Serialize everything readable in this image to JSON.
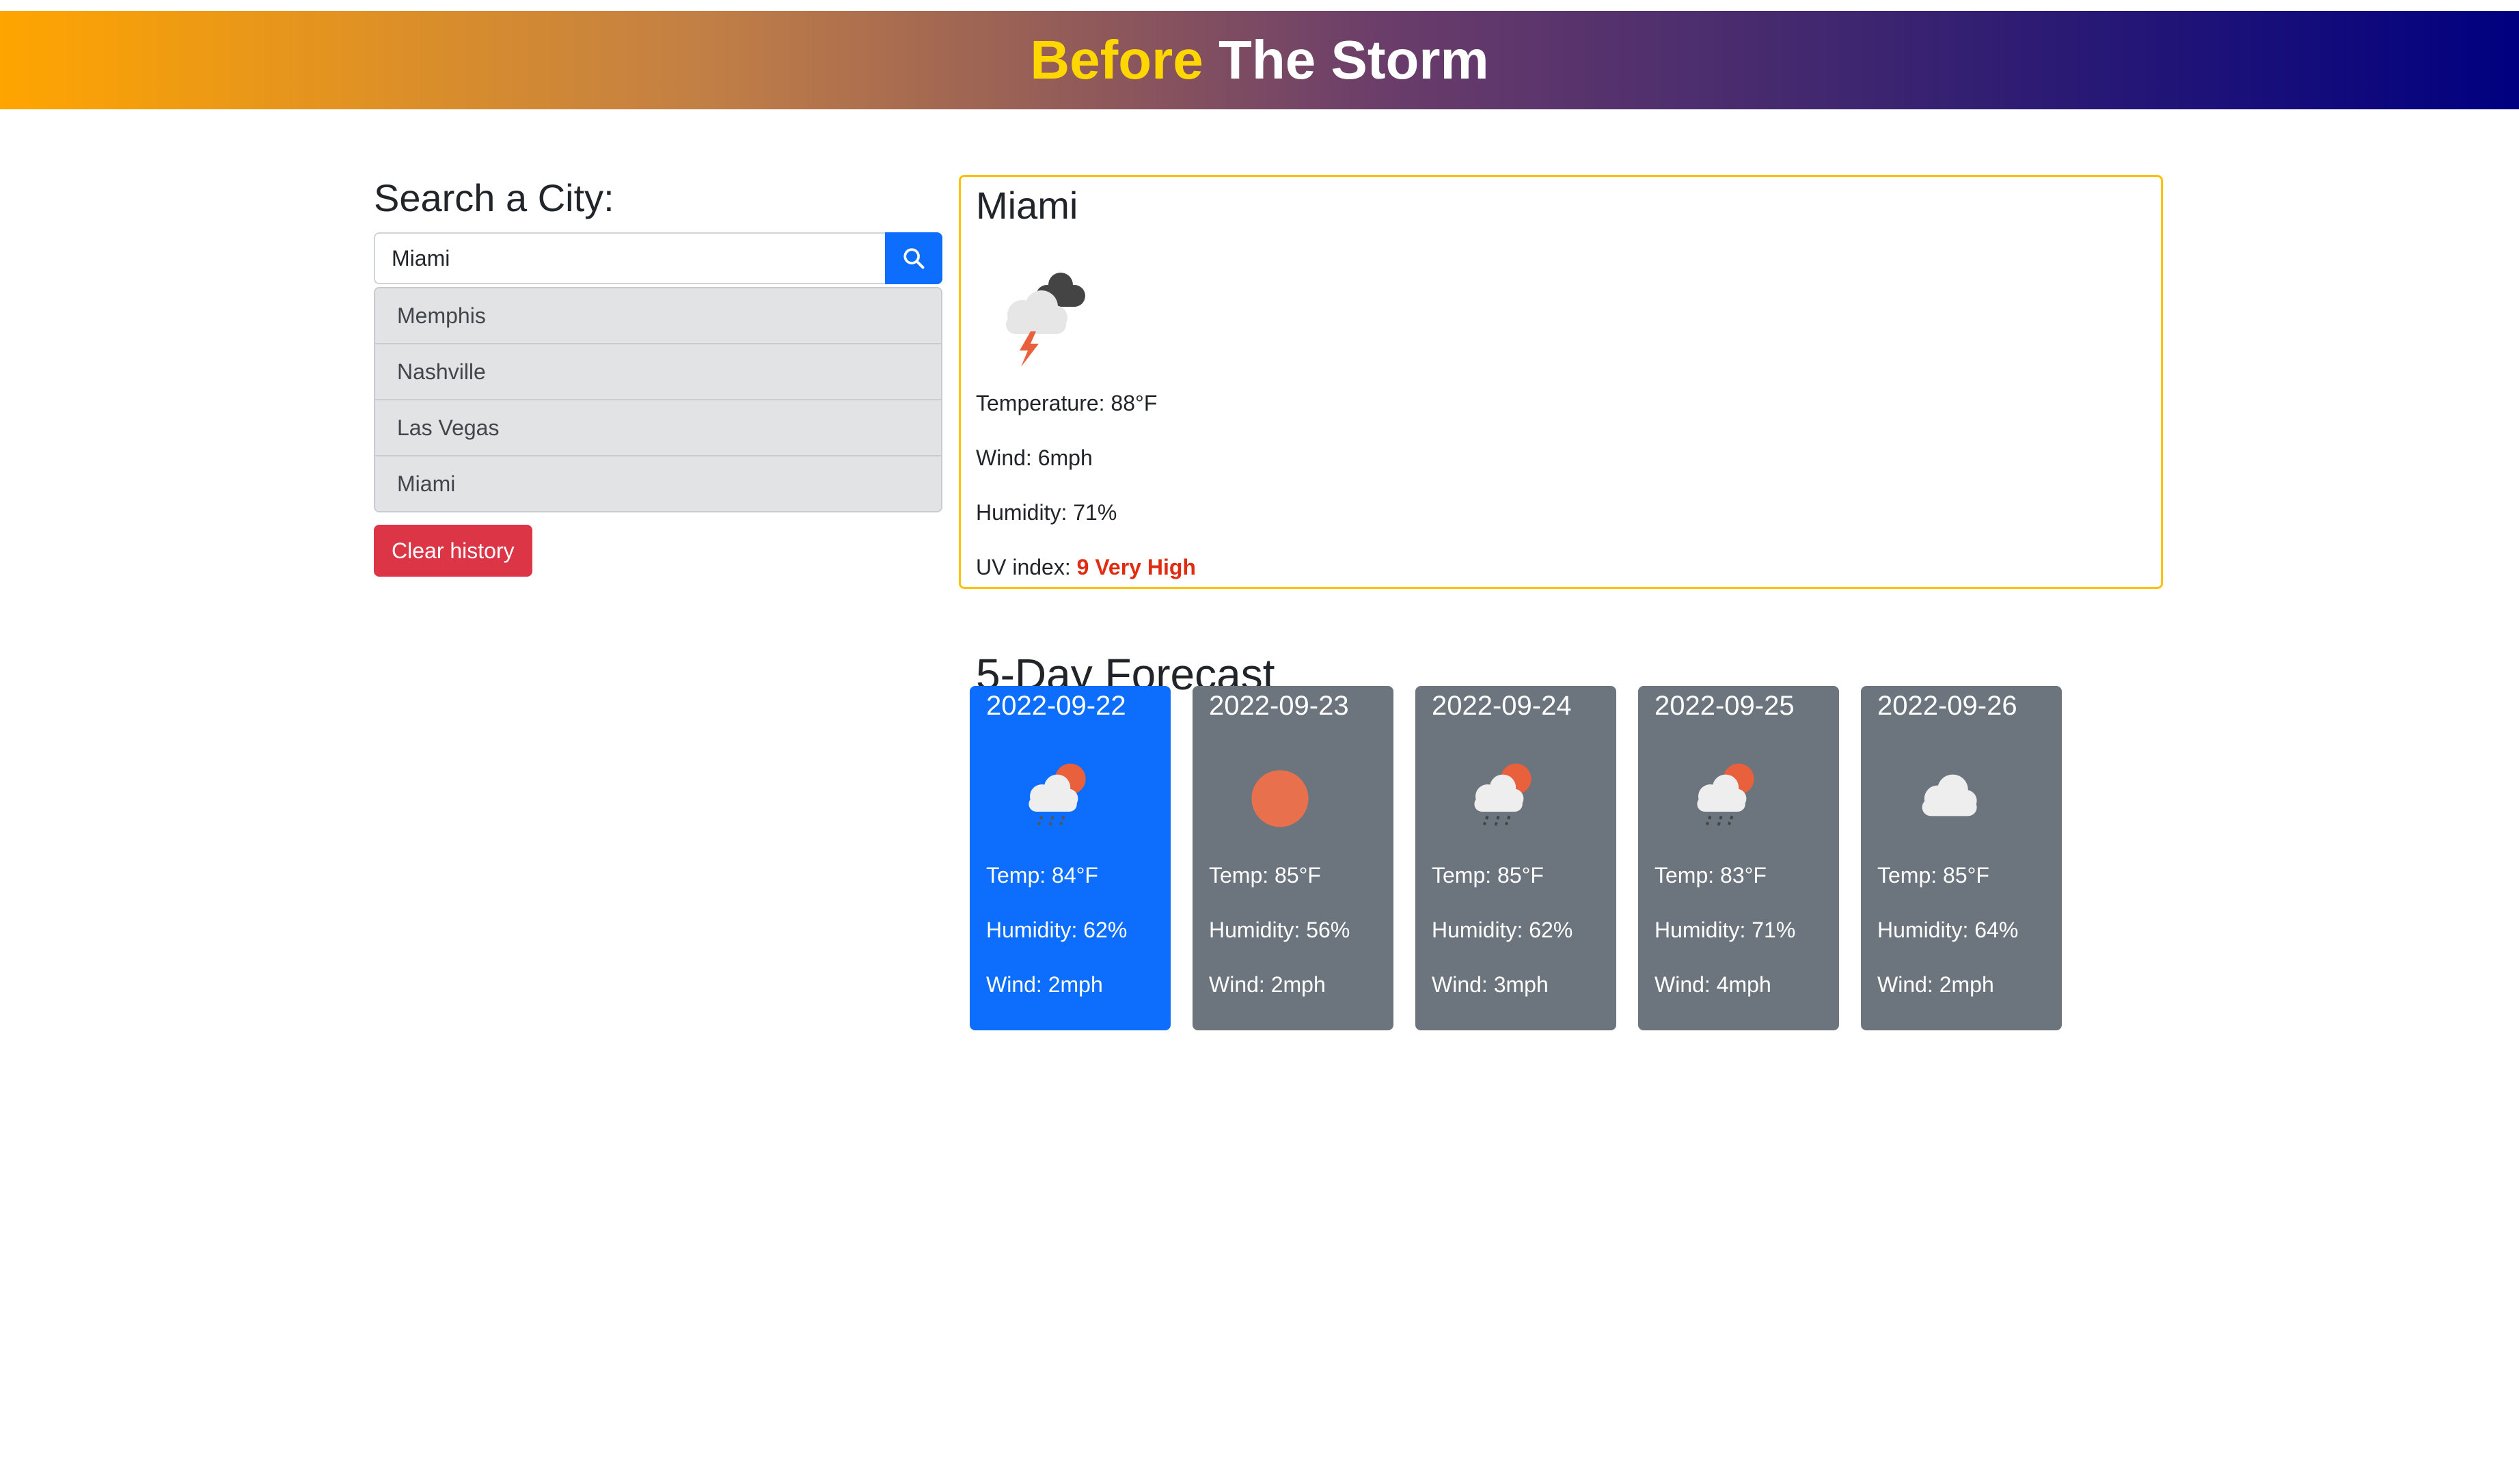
{
  "header": {
    "title_part1": "Before",
    "title_part2": "The Storm",
    "accent_color": "#ffd700"
  },
  "search": {
    "title": "Search a City:",
    "value": "Miami",
    "placeholder": "",
    "button_icon": "search-icon",
    "history": [
      "Memphis",
      "Nashville",
      "Las Vegas",
      "Miami"
    ],
    "clear_label": "Clear history"
  },
  "current": {
    "city": "Miami",
    "icon": "thunderstorm-icon",
    "temperature": "Temperature: 88°F",
    "wind": "Wind: 6mph",
    "humidity": "Humidity: 71%",
    "uv_label": "UV index:",
    "uv_value": "9 Very High",
    "uv_color": "#e02d12"
  },
  "forecast": {
    "title": "5-Day Forecast",
    "days": [
      {
        "date": "2022-09-22",
        "icon": "rain-sun-icon",
        "temp": "Temp: 84°F",
        "humidity": "Humidity: 62%",
        "wind": "Wind: 2mph"
      },
      {
        "date": "2022-09-23",
        "icon": "sun-icon",
        "temp": "Temp: 85°F",
        "humidity": "Humidity: 56%",
        "wind": "Wind: 2mph"
      },
      {
        "date": "2022-09-24",
        "icon": "rain-sun-icon",
        "temp": "Temp: 85°F",
        "humidity": "Humidity: 62%",
        "wind": "Wind: 3mph"
      },
      {
        "date": "2022-09-25",
        "icon": "rain-sun-icon",
        "temp": "Temp: 83°F",
        "humidity": "Humidity: 71%",
        "wind": "Wind: 4mph"
      },
      {
        "date": "2022-09-26",
        "icon": "cloud-icon",
        "temp": "Temp: 85°F",
        "humidity": "Humidity: 64%",
        "wind": "Wind: 2mph"
      }
    ],
    "active_color": "#0d6efd",
    "card_color": "#6c757d"
  }
}
